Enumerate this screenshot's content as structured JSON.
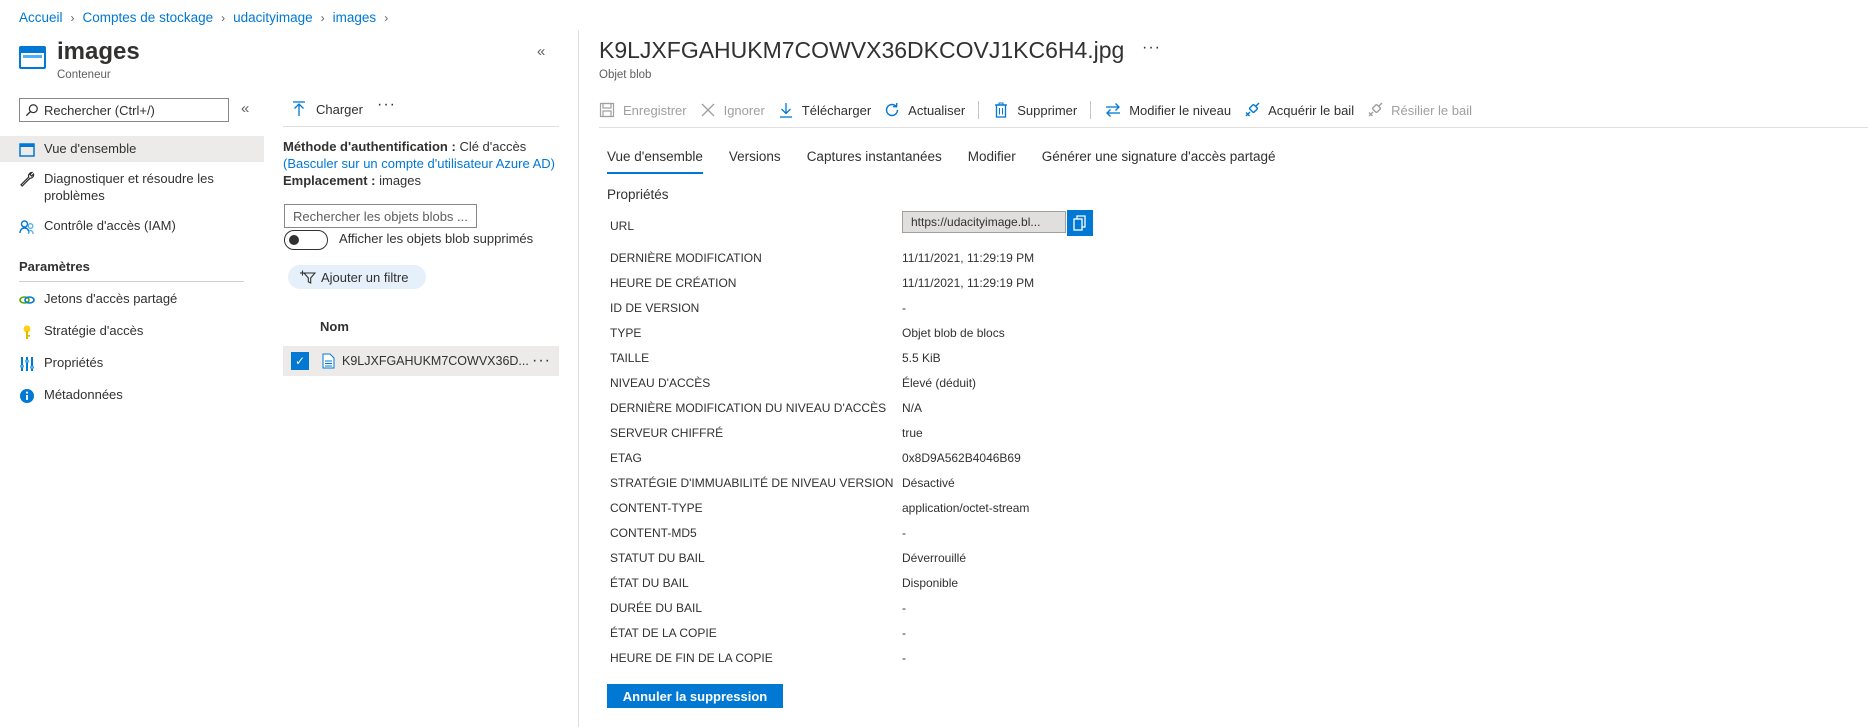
{
  "breadcrumb": [
    "Accueil",
    "Comptes de stockage",
    "udacityimage",
    "images"
  ],
  "left": {
    "title": "images",
    "subtitle": "Conteneur",
    "search_placeholder": "Rechercher (Ctrl+/)",
    "nav": [
      {
        "label": "Vue d'ensemble",
        "icon": "overview-icon",
        "selected": true
      },
      {
        "label": "Diagnostiquer et résoudre les problèmes",
        "icon": "wrench-icon"
      },
      {
        "label": "Contrôle d'accès (IAM)",
        "icon": "people-icon"
      }
    ],
    "section_title": "Paramètres",
    "settings": [
      {
        "label": "Jetons d'accès partagé",
        "icon": "link-icon"
      },
      {
        "label": "Stratégie d'accès",
        "icon": "key-icon"
      },
      {
        "label": "Propriétés",
        "icon": "properties-icon"
      },
      {
        "label": "Métadonnées",
        "icon": "info-icon"
      }
    ]
  },
  "middle": {
    "upload_label": "Charger",
    "more": "···",
    "auth_label": "Méthode d'authentification :",
    "auth_value": "Clé d'accès",
    "auth_switch": "(Basculer sur un compte d'utilisateur Azure AD)",
    "location_label": "Emplacement :",
    "location_value": "images",
    "blob_search_placeholder": "Rechercher les objets blobs ...",
    "toggle_label": "Afficher les objets blob supprimés",
    "filter_label": "Ajouter un filtre",
    "column_name": "Nom",
    "blobs": [
      {
        "name": "K9LJXFGAHUKM7COWVX36D...",
        "checked": true
      }
    ]
  },
  "blob": {
    "title": "K9LJXFGAHUKM7COWVX36DKCOVJ1KC6H4.jpg",
    "subtitle": "Objet blob",
    "commands": [
      {
        "label": "Enregistrer",
        "icon": "save-icon",
        "disabled": true
      },
      {
        "label": "Ignorer",
        "icon": "close-icon",
        "disabled": true
      },
      {
        "label": "Télécharger",
        "icon": "download-icon",
        "disabled": false
      },
      {
        "label": "Actualiser",
        "icon": "refresh-icon",
        "disabled": false
      },
      {
        "label": "Supprimer",
        "icon": "trash-icon",
        "disabled": false
      },
      {
        "label": "Modifier le niveau",
        "icon": "swap-icon",
        "disabled": false
      },
      {
        "label": "Acquérir le bail",
        "icon": "lease-icon",
        "disabled": false
      },
      {
        "label": "Résilier le bail",
        "icon": "break-lease-icon",
        "disabled": true
      }
    ],
    "tabs": [
      "Vue d'ensemble",
      "Versions",
      "Captures instantanées",
      "Modifier",
      "Générer une signature d'accès partagé"
    ],
    "properties_heading": "Propriétés",
    "url_label": "URL",
    "url_value": "https://udacityimage.bl...",
    "properties": [
      {
        "key": "DERNIÈRE MODIFICATION",
        "value": "11/11/2021, 11:29:19 PM"
      },
      {
        "key": "HEURE DE CRÉATION",
        "value": "11/11/2021, 11:29:19 PM"
      },
      {
        "key": "ID DE VERSION",
        "value": "-"
      },
      {
        "key": "TYPE",
        "value": "Objet blob de blocs"
      },
      {
        "key": "TAILLE",
        "value": "5.5 KiB"
      },
      {
        "key": "NIVEAU D'ACCÈS",
        "value": "Élevé (déduit)"
      },
      {
        "key": "DERNIÈRE MODIFICATION DU NIVEAU D'ACCÈS",
        "value": "N/A"
      },
      {
        "key": "SERVEUR CHIFFRÉ",
        "value": "true"
      },
      {
        "key": "ETAG",
        "value": "0x8D9A562B4046B69"
      },
      {
        "key": "STRATÉGIE D'IMMUABILITÉ DE NIVEAU VERSION",
        "value": "Désactivé"
      },
      {
        "key": "CONTENT-TYPE",
        "value": "application/octet-stream"
      },
      {
        "key": "CONTENT-MD5",
        "value": "-"
      },
      {
        "key": "STATUT DU BAIL",
        "value": "Déverrouillé"
      },
      {
        "key": "ÉTAT DU BAIL",
        "value": "Disponible"
      },
      {
        "key": "DURÉE DU BAIL",
        "value": "-"
      },
      {
        "key": "ÉTAT DE LA COPIE",
        "value": "-"
      },
      {
        "key": "HEURE DE FIN DE LA COPIE",
        "value": "-"
      }
    ],
    "undelete_label": "Annuler la suppression"
  }
}
